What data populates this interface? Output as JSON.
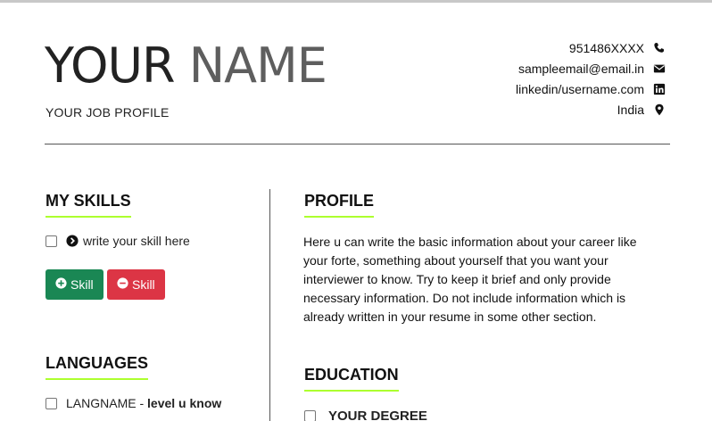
{
  "header": {
    "first_name": "YOUR",
    "last_name": "NAME",
    "job_profile": "YOUR JOB PROFILE"
  },
  "contact": {
    "phone": "951486XXXX",
    "email": "sampleemail@email.in",
    "linkedin": "linkedin/username.com",
    "location": "India"
  },
  "skills": {
    "title": "MY SKILLS",
    "items": [
      "write your skill here"
    ],
    "add_button": "Skill",
    "remove_button": "Skill"
  },
  "languages": {
    "title": "LANGUAGES",
    "items": [
      {
        "name": "LANGNAME",
        "separator": " - ",
        "level": "level u know"
      }
    ]
  },
  "profile": {
    "title": "PROFILE",
    "text": "Here u can write the basic information about your career like your forte, something about yourself that you want your interviewer to know. Try to keep it brief and only provide necessary information. Do not include information which is already written in your resume in some other section."
  },
  "education": {
    "title": "EDUCATION",
    "items": [
      "YOUR DEGREE"
    ]
  },
  "colors": {
    "accent_underline": "#adff2f",
    "add_button": "#1a8754",
    "remove_button": "#dc3545"
  }
}
